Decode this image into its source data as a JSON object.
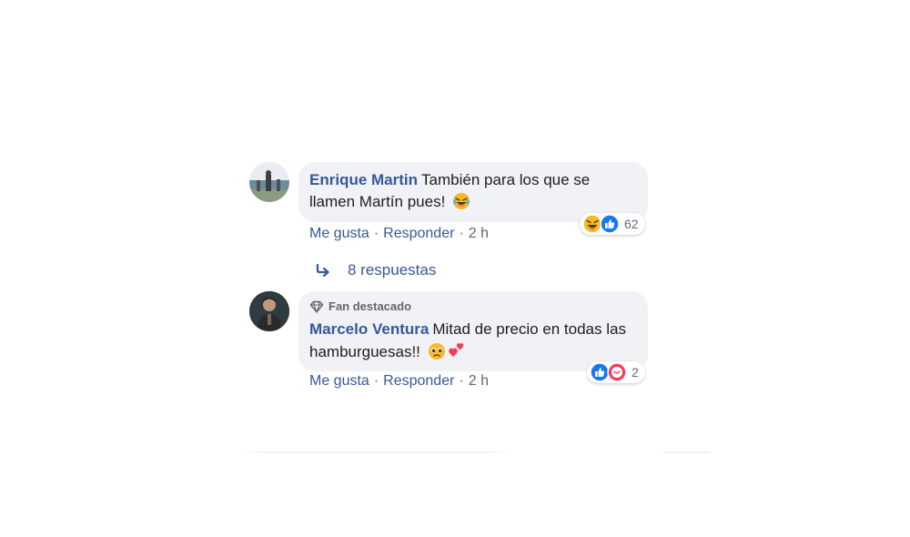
{
  "comments": [
    {
      "author": "Enrique Martin",
      "text": "También para los que se llamen Martín pues!",
      "emoji_icon": "laughing-tears-emoji",
      "reactions": {
        "icons": [
          "haha-icon",
          "like-icon"
        ],
        "count": "62"
      },
      "actions": {
        "like": "Me gusta",
        "reply": "Responder",
        "separator": "·",
        "time": "2 h"
      },
      "replies_label": "8 respuestas"
    },
    {
      "badge": "Fan destacado",
      "badge_icon": "diamond-icon",
      "author": "Marcelo Ventura",
      "text": "Mitad de precio en todas las hamburguesas!!",
      "emoji_icons": [
        "pleading-face-emoji",
        "two-hearts-emoji"
      ],
      "reactions": {
        "icons": [
          "like-icon",
          "care-icon"
        ],
        "count": "2"
      },
      "actions": {
        "like": "Me gusta",
        "reply": "Responder",
        "separator": "·",
        "time": "2 h"
      }
    }
  ],
  "colors": {
    "link": "#385898",
    "bubble": "#f0f2f5",
    "meta": "#65676b",
    "like_blue": "#1877f2",
    "love_red": "#f33e58",
    "haha_yellow": "#f7b928"
  }
}
